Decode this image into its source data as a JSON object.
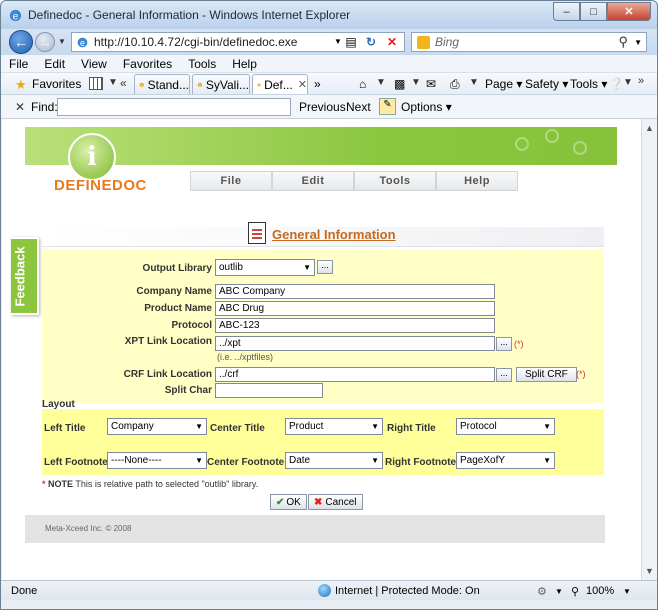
{
  "window": {
    "title": "Definedoc - General Information - Windows Internet Explorer",
    "controls": {
      "minimize": "‒",
      "maximize": "□",
      "close": "✕"
    }
  },
  "address": {
    "url": "http://10.10.4.72/cgi-bin/definedoc.exe",
    "search_placeholder": "Bing"
  },
  "menu": [
    "File",
    "Edit",
    "View",
    "Favorites",
    "Tools",
    "Help"
  ],
  "favorites_bar": {
    "favorites_label": "Favorites",
    "tabs": [
      {
        "label": "Stand..."
      },
      {
        "label": "SyVali..."
      },
      {
        "label": "Def...",
        "active": true
      }
    ],
    "overflow": "»",
    "commands": [
      "Page ▾",
      "Safety ▾",
      "Tools ▾"
    ]
  },
  "find_bar": {
    "label": "Find:",
    "value": "",
    "previous": "Previous",
    "next": "Next",
    "options": "Options ▾"
  },
  "site": {
    "brand": "DEFINEDOC",
    "logo_letter": "i",
    "nav": [
      "File",
      "Edit",
      "Tools",
      "Help"
    ],
    "feedback": "Feedback"
  },
  "general_info": {
    "heading": "General Information",
    "fields": {
      "output_library": {
        "label": "Output Library",
        "value": "outlib"
      },
      "company_name": {
        "label": "Company Name",
        "value": "ABC Company"
      },
      "product_name": {
        "label": "Product Name",
        "value": "ABC Drug"
      },
      "protocol": {
        "label": "Protocol",
        "value": "ABC-123"
      },
      "xpt_link": {
        "label": "XPT Link Location",
        "value": "../xpt",
        "hint": "(i.e. ../xptfiles)",
        "required": "(*)"
      },
      "crf_link": {
        "label": "CRF Link Location",
        "value": "../crf",
        "split_button": "Split CRF",
        "required": "(*)"
      },
      "split_char": {
        "label": "Split Char",
        "value": ""
      }
    },
    "browse_label": "..."
  },
  "layout": {
    "heading": "Layout",
    "left_title": {
      "label": "Left Title",
      "value": "Company"
    },
    "center_title": {
      "label": "Center Title",
      "value": "Product"
    },
    "right_title": {
      "label": "Right Title",
      "value": "Protocol"
    },
    "left_footnote": {
      "label": "Left Footnote",
      "value": "----None----"
    },
    "center_footnote": {
      "label": "Center Footnote",
      "value": "Date"
    },
    "right_footnote": {
      "label": "Right Footnote",
      "value": "PageXofY"
    }
  },
  "note": {
    "star": "*",
    "bold": "NOTE",
    "text": "This is relative path to selected \"outlib\" library."
  },
  "actions": {
    "ok": "OK",
    "cancel": "Cancel"
  },
  "footer": {
    "copyright": "Meta-Xceed Inc. ©  2008"
  },
  "status": {
    "left": "Done",
    "zone": "Internet | Protected Mode: On",
    "zoom": "100%"
  },
  "colors": {
    "banner_green": "#8cc63f",
    "brand_orange": "#e87a1e",
    "form_yellow": "#ffffc6",
    "layout_yellow": "#ffff99"
  }
}
